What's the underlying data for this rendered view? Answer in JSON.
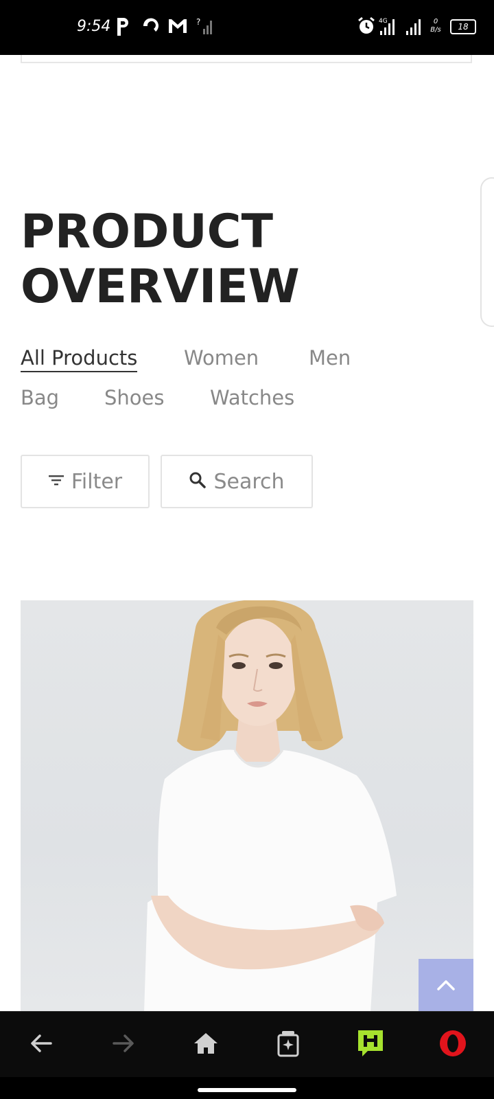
{
  "status_bar": {
    "time": "9:54",
    "network": "4G",
    "data_rate_top": "0",
    "data_rate_bottom": "B/s",
    "battery": "18"
  },
  "page": {
    "title_line1": "PRODUCT",
    "title_line2": "OVERVIEW",
    "tabs": [
      {
        "label": "All Products",
        "active": true
      },
      {
        "label": "Women",
        "active": false
      },
      {
        "label": "Men",
        "active": false
      },
      {
        "label": "Bag",
        "active": false
      },
      {
        "label": "Shoes",
        "active": false
      },
      {
        "label": "Watches",
        "active": false
      }
    ],
    "filter_label": "Filter",
    "search_label": "Search"
  },
  "colors": {
    "accent_back_to_top": "#a8b1e6",
    "opera_red": "#e1141c",
    "hype_green": "#a6e22e"
  },
  "icons": {
    "filter": "filter-lines-icon",
    "search": "magnifier-icon",
    "back_to_top": "chevron-up-icon"
  }
}
